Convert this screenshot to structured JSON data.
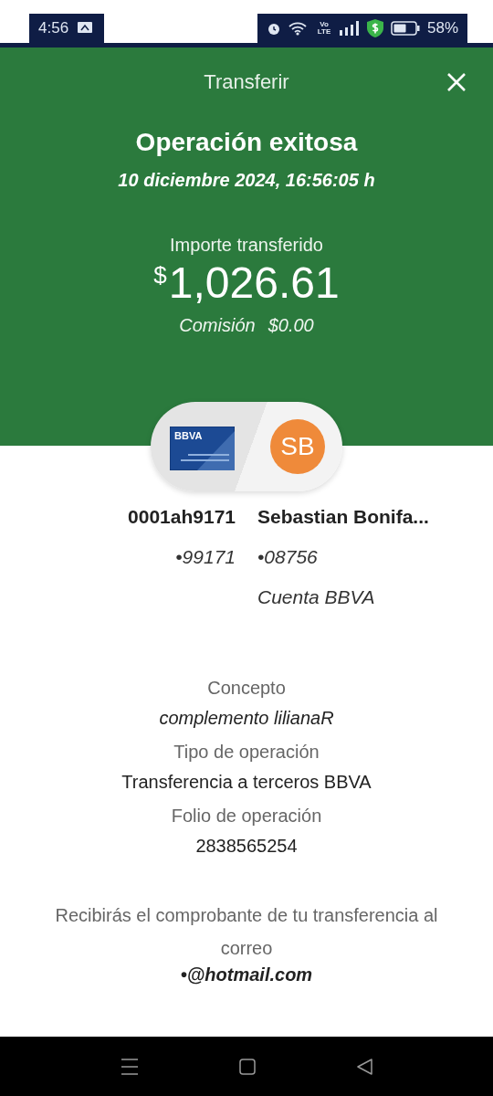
{
  "status_bar": {
    "time": "4:56",
    "network_label": "Vo LTE",
    "battery": "58%"
  },
  "header": {
    "title": "Transferir"
  },
  "result": {
    "title": "Operación exitosa",
    "date": "10 diciembre 2024, 16:56:05 h",
    "amount_label": "Importe transferido",
    "currency": "$",
    "amount": "1,026.61",
    "fee_label": "Comisión",
    "fee": "$0.00"
  },
  "transfer": {
    "card_brand": "BBVA",
    "recipient_initials": "SB"
  },
  "origin": {
    "name": "0001ah9171",
    "account": "•99171"
  },
  "destination": {
    "name": "Sebastian Bonifa...",
    "account": "•08756",
    "bank": "Cuenta BBVA"
  },
  "details": [
    {
      "label": "Concepto",
      "value": "complemento lilianaR",
      "italic": true
    },
    {
      "label": "Tipo de operación",
      "value": "Transferencia a terceros BBVA",
      "italic": false
    },
    {
      "label": "Folio de operación",
      "value": "2838565254",
      "italic": false
    }
  ],
  "footer": {
    "message": "Recibirás el comprobante de tu transferencia al correo",
    "email": "•@hotmail.com"
  }
}
